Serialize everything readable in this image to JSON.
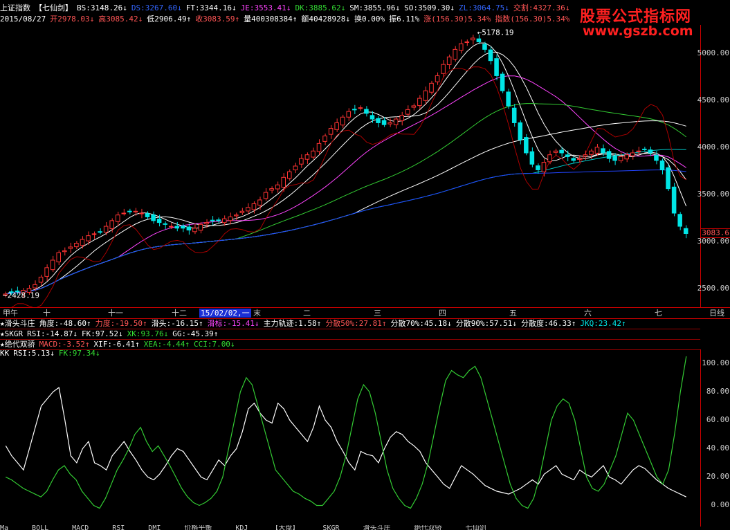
{
  "header": {
    "line1": [
      {
        "text": "上证指数",
        "cls": "w"
      },
      {
        "text": "【七仙剑】",
        "cls": "w"
      },
      {
        "text": "BS:3148.26↓",
        "cls": "w"
      },
      {
        "text": "DS:3267.60↓",
        "cls": "b"
      },
      {
        "text": "FT:3344.16↓",
        "cls": "w"
      },
      {
        "text": "JE:3553.41↓",
        "cls": "m"
      },
      {
        "text": "DK:3885.62↓",
        "cls": "g"
      },
      {
        "text": "SM:3855.96↓",
        "cls": "w"
      },
      {
        "text": "SO:3509.30↓",
        "cls": "w"
      },
      {
        "text": "ZL:3064.75↓",
        "cls": "b"
      },
      {
        "text": "交割:4327.36↓",
        "cls": "r"
      }
    ],
    "line2": [
      {
        "text": "2015/08/27",
        "cls": "w"
      },
      {
        "text": "开2978.03↓",
        "cls": "r"
      },
      {
        "text": "高3085.42↓",
        "cls": "r"
      },
      {
        "text": "低2906.49↑",
        "cls": "w"
      },
      {
        "text": "收3083.59↑",
        "cls": "r"
      },
      {
        "text": "量400308384↑",
        "cls": "w"
      },
      {
        "text": "额40428928↓",
        "cls": "w"
      },
      {
        "text": "换0.00%",
        "cls": "w"
      },
      {
        "text": "振6.11%",
        "cls": "w"
      },
      {
        "text": "涨(156.30)5.34%",
        "cls": "r"
      },
      {
        "text": "指数(156.30)5.34%",
        "cls": "r"
      }
    ]
  },
  "watermark": {
    "title": "股票公式指标网",
    "url": "www.gszb.com"
  },
  "price_axis": {
    "labels": [
      "5000.00",
      "4500.00",
      "4000.00",
      "3500.00",
      "3000.00",
      "2500.00"
    ],
    "current": "3083.6"
  },
  "chart_annotations": {
    "high": "5178.19",
    "low": "2428.19"
  },
  "time_axis": {
    "months": [
      "甲午",
      "十",
      "十一",
      "十二",
      "15/02/02,一",
      "末",
      "二",
      "三",
      "四",
      "五",
      "六",
      "七"
    ],
    "period": "日线"
  },
  "indicators": {
    "row1": [
      {
        "text": "★滑头斗庄",
        "cls": "ind-name"
      },
      {
        "text": "角度:-48.60↑",
        "cls": "w"
      },
      {
        "text": "力度:-19.50↑",
        "cls": "r"
      },
      {
        "text": "滑头:-16.15↑",
        "cls": "w"
      },
      {
        "text": "滑标:-15.41↓",
        "cls": "m"
      },
      {
        "text": "主力轨迹:1.58↑",
        "cls": "w"
      },
      {
        "text": "分散50%:27.81↑",
        "cls": "r"
      },
      {
        "text": "分散70%:45.18↓",
        "cls": "w"
      },
      {
        "text": "分散90%:57.51↓",
        "cls": "w"
      },
      {
        "text": "分散度:46.33↑",
        "cls": "w"
      },
      {
        "text": "JKQ:23.42↑",
        "cls": "c"
      }
    ],
    "row2": [
      {
        "text": "★SKGR",
        "cls": "ind-name"
      },
      {
        "text": "RSI:-14.87↓",
        "cls": "w"
      },
      {
        "text": "FK:97.52↓",
        "cls": "w"
      },
      {
        "text": "XK:93.76↓",
        "cls": "g"
      },
      {
        "text": "GG:-45.39↑",
        "cls": "w"
      }
    ],
    "row3": [
      {
        "text": "★绝代双骄",
        "cls": "ind-name"
      },
      {
        "text": "MACD:-3.52↑",
        "cls": "r"
      },
      {
        "text": "XIF:-6.41↑",
        "cls": "w"
      },
      {
        "text": "XEA:-4.44↑",
        "cls": "g"
      },
      {
        "text": "CCI:7.00↓",
        "cls": "g"
      }
    ],
    "row4": [
      {
        "text": "KK",
        "cls": "w"
      },
      {
        "text": "RSI:5.13↓",
        "cls": "w"
      },
      {
        "text": "FK:97.34↓",
        "cls": "g"
      }
    ]
  },
  "sub_axis": {
    "labels": [
      "100.00",
      "80.00",
      "60.00",
      "40.00",
      "20.00",
      "0.00"
    ]
  },
  "bottom_tabs": [
    "Ma",
    "BOLL",
    "MACD",
    "RSI",
    "DMI",
    "价格平衡",
    "KDJ",
    "【大盘】",
    "SKGR",
    "滑头斗庄",
    "绝代双骄",
    "七仙剑"
  ],
  "colors": {
    "up": "#ff3333",
    "down": "#00e5e5",
    "ma_white": "#ffffff",
    "ma_magenta": "#ff44ff",
    "ma_green": "#33cc33",
    "ma_cyan": "#00cccc",
    "ma_blue": "#2244ff",
    "ma_darkred": "#aa0000",
    "kk_rsi": "#ffffff",
    "kk_fk": "#33cc33"
  },
  "chart_data": {
    "type": "candlestick",
    "ylim": [
      2300,
      5300
    ],
    "closes": [
      2440,
      2460,
      2470,
      2480,
      2500,
      2540,
      2620,
      2720,
      2800,
      2880,
      2900,
      2940,
      2980,
      3020,
      3060,
      3080,
      3100,
      3160,
      3220,
      3280,
      3300,
      3320,
      3320,
      3300,
      3260,
      3220,
      3200,
      3180,
      3160,
      3140,
      3140,
      3120,
      3140,
      3180,
      3200,
      3220,
      3220,
      3240,
      3260,
      3280,
      3320,
      3360,
      3400,
      3440,
      3520,
      3560,
      3600,
      3680,
      3740,
      3800,
      3880,
      3920,
      3960,
      4040,
      4120,
      4200,
      4260,
      4320,
      4380,
      4400,
      4420,
      4360,
      4300,
      4260,
      4240,
      4260,
      4300,
      4340,
      4400,
      4440,
      4520,
      4600,
      4680,
      4760,
      4880,
      4960,
      5040,
      5100,
      5120,
      5160,
      5120,
      5040,
      4920,
      4760,
      4600,
      4440,
      4260,
      4080,
      3940,
      3820,
      3760,
      3840,
      3920,
      3960,
      3940,
      3900,
      3860,
      3880,
      3920,
      3960,
      4000,
      3940,
      3880,
      3860,
      3900,
      3920,
      3940,
      3960,
      3980,
      3940,
      3860,
      3760,
      3560,
      3300,
      3160,
      3083
    ],
    "kk_rsi": [
      42,
      35,
      30,
      25,
      40,
      55,
      70,
      75,
      80,
      83,
      60,
      35,
      30,
      40,
      45,
      30,
      28,
      25,
      35,
      40,
      45,
      38,
      32,
      25,
      20,
      18,
      22,
      28,
      35,
      40,
      38,
      32,
      26,
      20,
      18,
      25,
      32,
      28,
      35,
      40,
      52,
      68,
      72,
      65,
      60,
      58,
      72,
      68,
      60,
      55,
      50,
      45,
      55,
      70,
      60,
      55,
      45,
      38,
      30,
      25,
      38,
      36,
      35,
      30,
      40,
      48,
      52,
      50,
      45,
      42,
      38,
      30,
      25,
      20,
      15,
      12,
      20,
      28,
      25,
      22,
      18,
      14,
      12,
      10,
      9,
      8,
      10,
      12,
      15,
      18,
      15,
      22,
      25,
      28,
      22,
      20,
      18,
      25,
      22,
      20,
      24,
      28,
      20,
      18,
      15,
      20,
      25,
      28,
      26,
      22,
      18,
      15,
      12,
      10,
      8,
      6
    ],
    "kk_fk": [
      20,
      18,
      15,
      12,
      10,
      8,
      6,
      10,
      18,
      25,
      28,
      22,
      18,
      10,
      5,
      0,
      -2,
      5,
      15,
      25,
      32,
      40,
      50,
      55,
      45,
      38,
      42,
      35,
      28,
      20,
      12,
      6,
      2,
      0,
      2,
      5,
      10,
      20,
      40,
      60,
      80,
      90,
      85,
      70,
      55,
      40,
      25,
      20,
      15,
      10,
      8,
      5,
      3,
      0,
      0,
      5,
      10,
      20,
      35,
      55,
      75,
      85,
      80,
      65,
      45,
      25,
      12,
      5,
      0,
      -2,
      5,
      15,
      30,
      50,
      70,
      88,
      95,
      92,
      90,
      95,
      98,
      90,
      75,
      60,
      45,
      30,
      15,
      5,
      0,
      -2,
      5,
      20,
      40,
      60,
      70,
      75,
      72,
      60,
      40,
      20,
      12,
      10,
      15,
      25,
      35,
      50,
      65,
      60,
      50,
      40,
      30,
      20,
      15,
      25,
      50,
      80,
      105
    ]
  }
}
